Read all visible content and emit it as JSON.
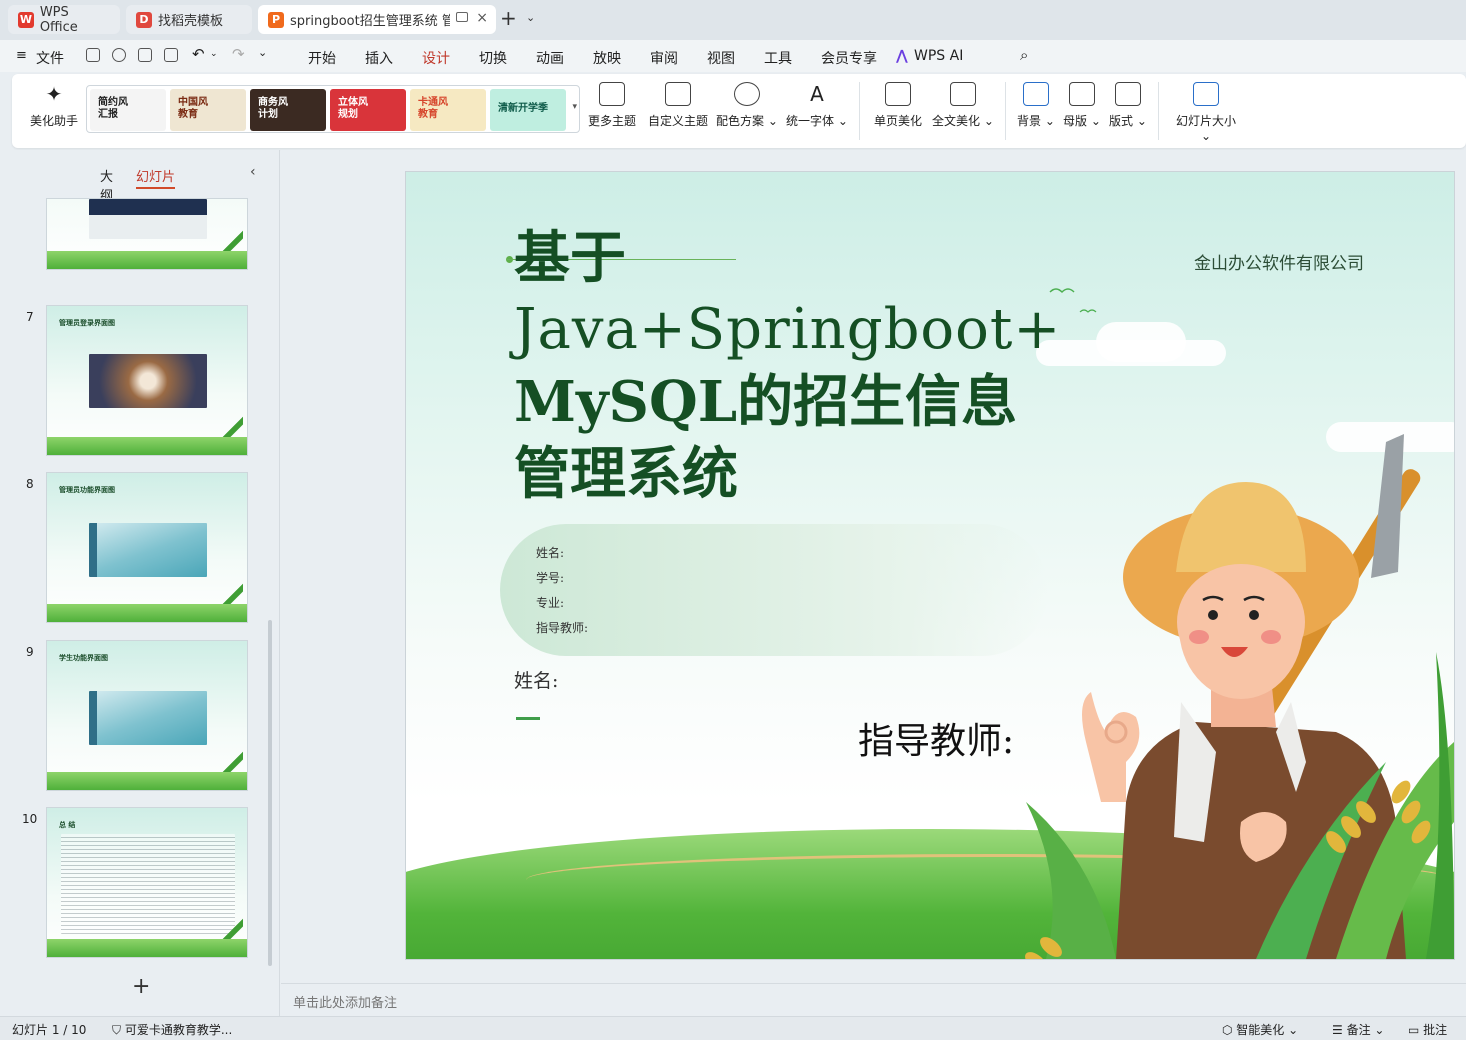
{
  "tabs": {
    "wps": "WPS Office",
    "templates": "找稻壳模板",
    "document": "springboot招生管理系统 管"
  },
  "menu": {
    "file": "文件",
    "items": [
      "开始",
      "插入",
      "设计",
      "切换",
      "动画",
      "放映",
      "审阅",
      "视图",
      "工具",
      "会员专享"
    ],
    "active": "设计",
    "ai": "WPS AI"
  },
  "ribbon": {
    "beautify_assistant": "美化助手",
    "themes": [
      {
        "label": "简约风\n汇报",
        "bg": "#f4f4f4",
        "fg": "#222222"
      },
      {
        "label": "中国风\n教育",
        "bg": "#efe6d2",
        "fg": "#7a2a12"
      },
      {
        "label": "商务风\n计划",
        "bg": "#3b2a22",
        "fg": "#ffffff"
      },
      {
        "label": "立体风\n规划",
        "bg": "#d9343a",
        "fg": "#ffffff"
      },
      {
        "label": "卡通风\n教育",
        "bg": "#f6e9c2",
        "fg": "#d6452b"
      },
      {
        "label": "清新开学季",
        "bg": "#bfeee0",
        "fg": "#0d5a48"
      }
    ],
    "more_themes": "更多主题",
    "custom_theme": "自定义主题",
    "color_scheme": "配色方案",
    "unify_font": "统一字体",
    "single_beautify": "单页美化",
    "full_beautify": "全文美化",
    "background": "背景",
    "master": "母版",
    "layout": "版式",
    "slide_size": "幻灯片大小"
  },
  "left_panel": {
    "outline_tab": "大纲",
    "slides_tab": "幻灯片",
    "slides": [
      {
        "num": "",
        "title": ""
      },
      {
        "num": "7",
        "title": "管理员登录界面图"
      },
      {
        "num": "8",
        "title": "管理员功能界面图"
      },
      {
        "num": "9",
        "title": "学生功能界面图"
      },
      {
        "num": "10",
        "title": "总 结"
      }
    ]
  },
  "slide": {
    "title_line1": "基于",
    "title_line2": "Java+Springboot+",
    "title_line3": "MySQL的招生信息",
    "title_line4": "管理系统",
    "company": "金山办公软件有限公司",
    "info": [
      "姓名:",
      "学号:",
      "专业:",
      "指导教师:"
    ],
    "name_label": "姓名:",
    "teacher_label": "指导教师:"
  },
  "notes_placeholder": "单击此处添加备注",
  "status": {
    "slide_counter": "幻灯片 1 / 10",
    "theme_name": "可爱卡通教育教学...",
    "smart_beautify": "智能美化",
    "notes": "备注",
    "comment": "批注"
  },
  "colors": {
    "accent": "#d14a2a",
    "title_green": "#154f24"
  }
}
